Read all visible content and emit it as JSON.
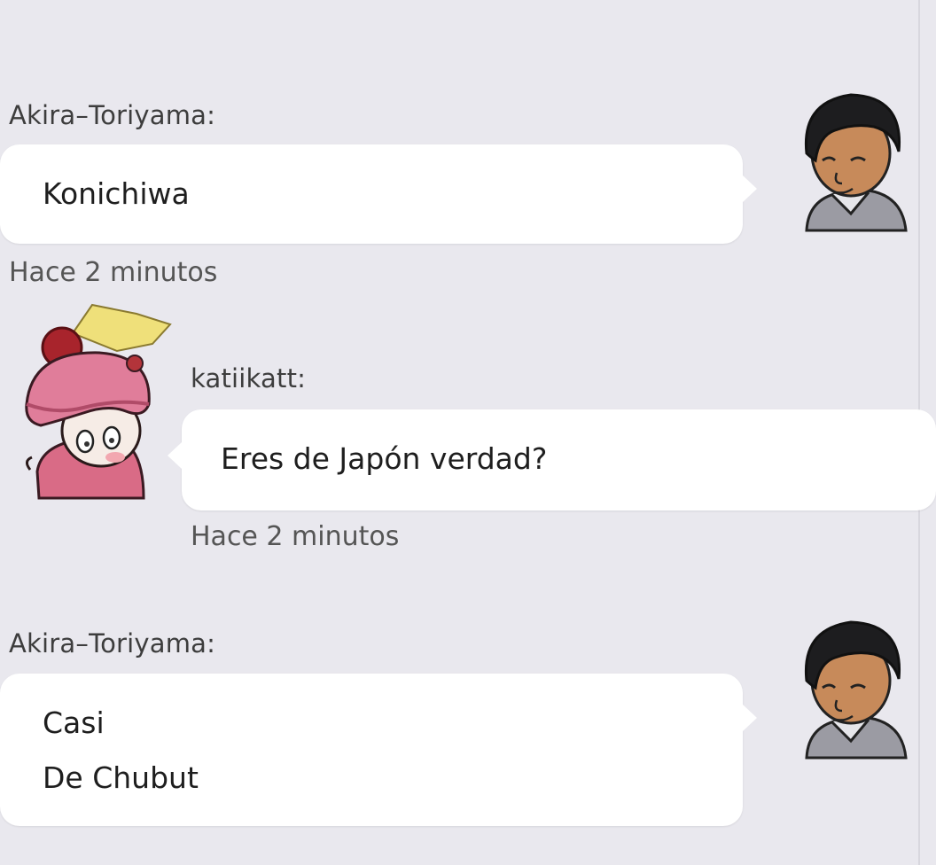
{
  "messages": [
    {
      "sender": "Akira–Toriyama:",
      "lines": [
        "Konichiwa"
      ],
      "time": "Hace 2 minutos",
      "avatar": "man-avatar-icon"
    },
    {
      "sender": "katiikatt:",
      "lines": [
        "Eres de Japón verdad?"
      ],
      "time": "Hace 2 minutos",
      "avatar": "girl-avatar-icon"
    },
    {
      "sender": "Akira–Toriyama:",
      "lines": [
        "Casi",
        "De Chubut"
      ],
      "avatar": "man-avatar-icon"
    }
  ],
  "colors": {
    "background": "#e9e8ee",
    "bubble": "#ffffff",
    "text": "#1e1e1e",
    "meta": "#555555"
  }
}
